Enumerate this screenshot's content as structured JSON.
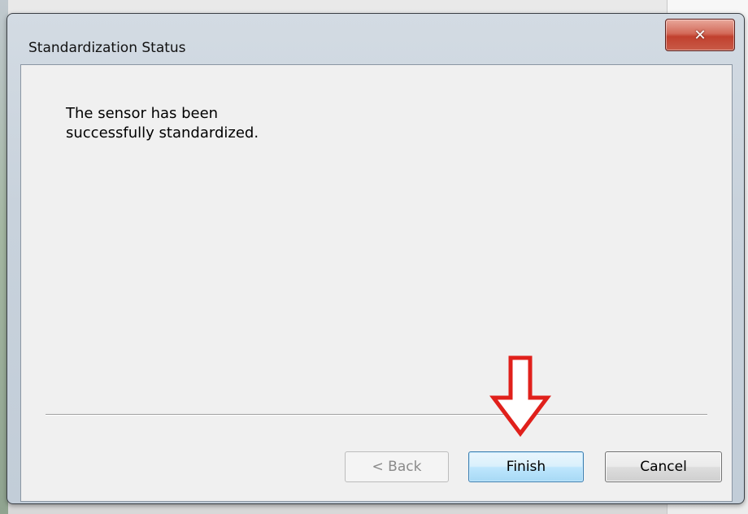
{
  "dialog": {
    "title": "Standardization Status",
    "close_glyph": "✕",
    "message_line1": "The sensor has been",
    "message_line2": "successfully standardized."
  },
  "buttons": {
    "back_label": "< Back",
    "finish_label": "Finish",
    "cancel_label": "Cancel"
  },
  "annotation": {
    "arrow_color": "#e0201b",
    "icon": "down-arrow-icon"
  },
  "colors": {
    "finish_border": "#3c7fb1",
    "close_button": "#c1402e"
  }
}
